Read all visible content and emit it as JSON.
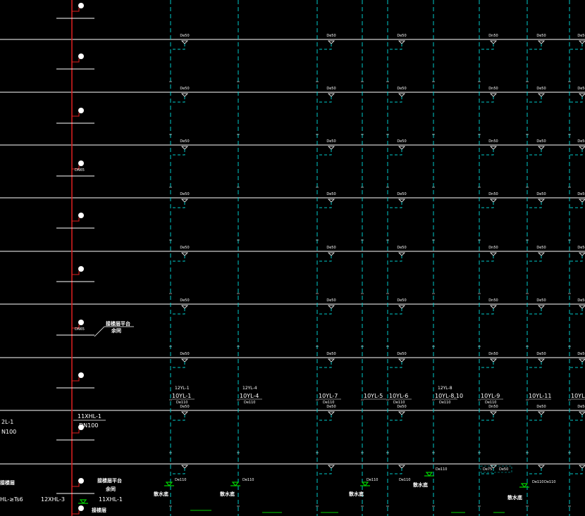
{
  "colors": {
    "background": "#000000",
    "floor_line": "#ffffff",
    "riser": "#00c8c8",
    "fire_riser": "#e02020",
    "valve": "#00d000",
    "text": "#ffffff"
  },
  "fire_riser": {
    "valve_labels": [
      {
        "floor": 3,
        "text": "DN65"
      },
      {
        "floor": 6,
        "text": "DN65"
      }
    ],
    "note_upper": [
      "接楼层平台",
      "余同"
    ],
    "note_lower": [
      "接楼层平台",
      "余同"
    ],
    "tag_11XHL1_top": "11XHL-1",
    "tag_dn100": "DN100",
    "tag_12XHL3": "12XHL-3",
    "tag_11XHL1_bottom": "11XHL-1",
    "bottom_chinese": "接楼层"
  },
  "left_edge": {
    "tag_2L1": "2L-1",
    "tag_N100": "N100",
    "tag_HL_TS6": "HL-≥Ts6",
    "left_bottom_chinese": "接楼层"
  },
  "branch_labels": {
    "dn50": "De50",
    "dn50_at_col4": "Dn50",
    "de75": "De75",
    "de110": "De110"
  },
  "risers": [
    {
      "tag_top": "12YL-1",
      "tag_main": "10YL-1",
      "size": "De110"
    },
    {
      "tag_top": "12YL-4",
      "tag_main": "10YL-4",
      "size": "De110"
    },
    {
      "tag_top": "",
      "tag_main": "10YL-7",
      "size": "De110"
    },
    {
      "tag_top": "",
      "tag_main": "10YL-5",
      "size": ""
    },
    {
      "tag_top": "",
      "tag_main": "10YL-6",
      "size": "De110"
    },
    {
      "tag_top": "12YL-8",
      "tag_main": "10YL-8,10",
      "size": "De110"
    },
    {
      "tag_top": "",
      "tag_main": "10YL-9",
      "size": "De110"
    },
    {
      "tag_top": "",
      "tag_main": "10YL-11",
      "size": ""
    },
    {
      "tag_top": "",
      "tag_main": "10YL",
      "size": ""
    }
  ],
  "bottom": {
    "drain_labels": [
      "散水底",
      "散水底",
      "散水底",
      "散水底",
      "散水底"
    ],
    "size_labels": [
      "De110",
      "De110",
      "De110",
      "De110",
      "De110",
      "De110",
      "De75",
      "De50",
      "De110"
    ]
  }
}
